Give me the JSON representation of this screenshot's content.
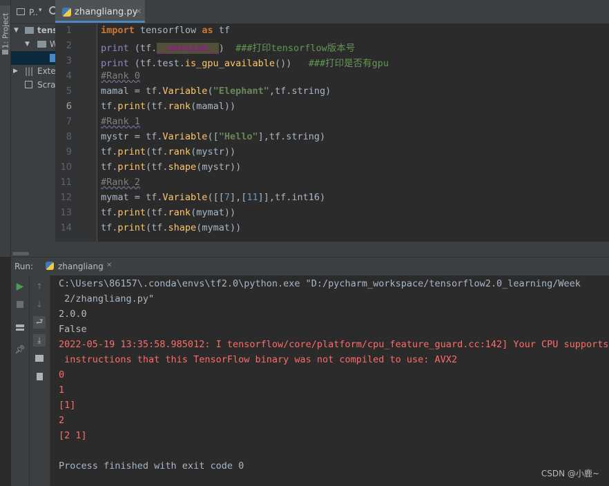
{
  "left_strip": {
    "project_tab_label": "1: Project"
  },
  "project_panel": {
    "header_label": "P..",
    "tree": [
      {
        "label": "tens",
        "indent": 0,
        "expanded": true,
        "bold": true
      },
      {
        "label": "W",
        "indent": 1,
        "expanded": true,
        "bold": false
      },
      {
        "label": "",
        "indent": 2,
        "expanded": false,
        "selected": true
      },
      {
        "label": "Exte",
        "indent": 0,
        "expanded": false
      },
      {
        "label": "Scra",
        "indent": 0,
        "expanded": false
      }
    ]
  },
  "editor": {
    "tab_label": "zhangliang.py",
    "line_numbers": [
      "1",
      "2",
      "3",
      "4",
      "5",
      "6",
      "7",
      "8",
      "9",
      "10",
      "11",
      "12",
      "13",
      "14"
    ],
    "current_line": 6
  },
  "code": {
    "l1_import": "import",
    "l1_rest": " tensorflow ",
    "l1_as": "as",
    "l1_alias": " tf",
    "l2_print": "print",
    "l2_a": " (tf.",
    "l2_version": "__version__",
    "l2_b": ")  ",
    "l2_comment": "###打印tensorflow版本号",
    "l3_print": "print",
    "l3_a": " (tf.test.",
    "l3_fn": "is_gpu_available",
    "l3_b": "())   ",
    "l3_comment": "###打印是否有gpu",
    "l4": "#Rank 0",
    "l5_a": "mamal = tf.",
    "l5_fn": "Variable",
    "l5_b": "(",
    "l5_str": "\"Elephant\"",
    "l5_c": ",tf.string)",
    "l6_a": "tf.",
    "l6_fn1": "print",
    "l6_b": "(tf.",
    "l6_fn2": "rank",
    "l6_c": "(mamal))",
    "l7": "#Rank 1",
    "l8_a": "mystr = tf.",
    "l8_fn": "Variable",
    "l8_b": "([",
    "l8_str": "\"Hello\"",
    "l8_c": "],tf.string)",
    "l9_a": "tf.",
    "l9_fn1": "print",
    "l9_b": "(tf.",
    "l9_fn2": "rank",
    "l9_c": "(mystr))",
    "l10_a": "tf.",
    "l10_fn1": "print",
    "l10_b": "(tf.",
    "l10_fn2": "shape",
    "l10_c": "(mystr))",
    "l11": "#Rank 2",
    "l12_a": "mymat = tf.",
    "l12_fn": "Variable",
    "l12_b": "([[",
    "l12_n1": "7",
    "l12_c": "],[",
    "l12_n2": "11",
    "l12_d": "]],tf.int16)",
    "l13_a": "tf.",
    "l13_fn1": "print",
    "l13_b": "(tf.",
    "l13_fn2": "rank",
    "l13_c": "(mymat))",
    "l14_a": "tf.",
    "l14_fn1": "print",
    "l14_b": "(tf.",
    "l14_fn2": "shape",
    "l14_c": "(mymat))"
  },
  "run": {
    "label": "Run:",
    "tab_label": "zhangliang",
    "console": [
      {
        "text": "C:\\Users\\86157\\.conda\\envs\\tf2.0\\python.exe \"D:/pycharm_workspace/tensorflow2.0_learning/Week",
        "kind": "gray"
      },
      {
        "text": " 2/zhangliang.py\"",
        "kind": "gray"
      },
      {
        "text": "2.0.0",
        "kind": "norm"
      },
      {
        "text": "False",
        "kind": "norm"
      },
      {
        "text": "2022-05-19 13:35:58.985012: I tensorflow/core/platform/cpu_feature_guard.cc:142] Your CPU supports",
        "kind": "err"
      },
      {
        "text": " instructions that this TensorFlow binary was not compiled to use: AVX2",
        "kind": "err"
      },
      {
        "text": "0",
        "kind": "err"
      },
      {
        "text": "1",
        "kind": "err"
      },
      {
        "text": "[1]",
        "kind": "err"
      },
      {
        "text": "2",
        "kind": "err"
      },
      {
        "text": "[2 1]",
        "kind": "err"
      },
      {
        "text": "",
        "kind": "norm"
      },
      {
        "text": "Process finished with exit code 0",
        "kind": "gray"
      }
    ]
  },
  "watermark": "CSDN @小鹿~",
  "colors": {
    "accent": "#4a88c7",
    "error": "#ff6b68",
    "run_green": "#499c54"
  }
}
